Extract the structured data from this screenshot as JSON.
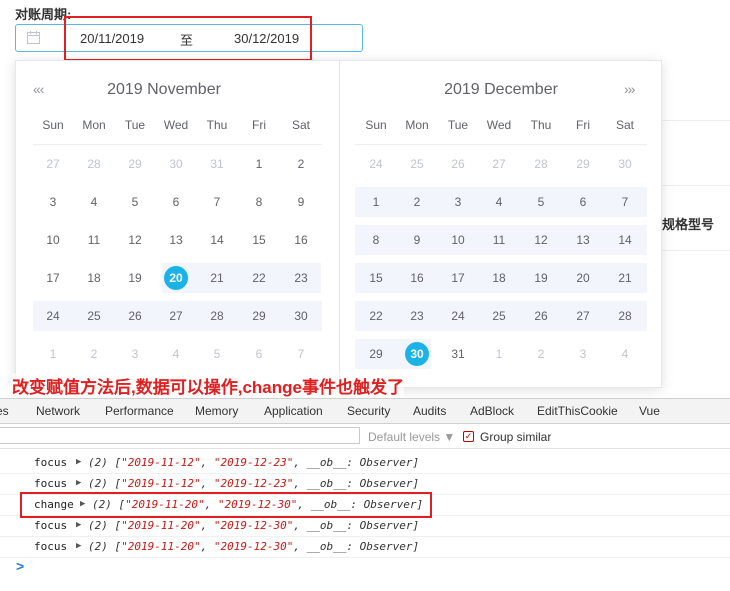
{
  "form": {
    "label": "对账周期:",
    "start_value": "20/11/2019",
    "separator": "至",
    "end_value": "30/12/2019"
  },
  "background_page": {
    "right_label": "规格型号"
  },
  "picker": {
    "left": {
      "title": "2019 November",
      "nav": "«‹",
      "weekdays": [
        "Sun",
        "Mon",
        "Tue",
        "Wed",
        "Thu",
        "Fri",
        "Sat"
      ],
      "rows": [
        [
          "27",
          "28",
          "29",
          "30",
          "31",
          "1",
          "2"
        ],
        [
          "3",
          "4",
          "5",
          "6",
          "7",
          "8",
          "9"
        ],
        [
          "10",
          "11",
          "12",
          "13",
          "14",
          "15",
          "16"
        ],
        [
          "17",
          "18",
          "19",
          "20",
          "21",
          "22",
          "23"
        ],
        [
          "24",
          "25",
          "26",
          "27",
          "28",
          "29",
          "30"
        ],
        [
          "1",
          "2",
          "3",
          "4",
          "5",
          "6",
          "7"
        ]
      ],
      "selected": "20"
    },
    "right": {
      "title": "2019 December",
      "nav": "›»",
      "weekdays": [
        "Sun",
        "Mon",
        "Tue",
        "Wed",
        "Thu",
        "Fri",
        "Sat"
      ],
      "rows": [
        [
          "24",
          "25",
          "26",
          "27",
          "28",
          "29",
          "30"
        ],
        [
          "1",
          "2",
          "3",
          "4",
          "5",
          "6",
          "7"
        ],
        [
          "8",
          "9",
          "10",
          "11",
          "12",
          "13",
          "14"
        ],
        [
          "15",
          "16",
          "17",
          "18",
          "19",
          "20",
          "21"
        ],
        [
          "22",
          "23",
          "24",
          "25",
          "26",
          "27",
          "28"
        ],
        [
          "29",
          "30",
          "31",
          "1",
          "2",
          "3",
          "4"
        ]
      ],
      "selected": "30"
    }
  },
  "annotation": "改变赋值方法后,数据可以操作,change事件也触发了",
  "devtools": {
    "tabs": [
      "es",
      "Network",
      "Performance",
      "Memory",
      "Application",
      "Security",
      "Audits",
      "AdBlock",
      "EditThisCookie",
      "Vue"
    ],
    "levels_label": "Default levels ▼",
    "check_mark": "✓",
    "group_similar": "Group similar",
    "logs": [
      {
        "event": "focus",
        "prefix": "(2) [",
        "a": "\"2019-11-12\"",
        "b": "\"2019-12-23\"",
        "suffix": ", __ob__: Observer]"
      },
      {
        "event": "focus",
        "prefix": "(2) [",
        "a": "\"2019-11-12\"",
        "b": "\"2019-12-23\"",
        "suffix": ", __ob__: Observer]"
      },
      {
        "event": "change",
        "prefix": "(2) [",
        "a": "\"2019-11-20\"",
        "b": "\"2019-12-30\"",
        "suffix": ", __ob__: Observer]"
      },
      {
        "event": "focus",
        "prefix": "(2) [",
        "a": "\"2019-11-20\"",
        "b": "\"2019-12-30\"",
        "suffix": ", __ob__: Observer]"
      },
      {
        "event": "focus",
        "prefix": "(2) [",
        "a": "\"2019-11-20\"",
        "b": "\"2019-12-30\"",
        "suffix": ", __ob__: Observer]"
      }
    ],
    "prompt": ">"
  },
  "colors": {
    "accent": "#1bb3e6",
    "highlight": "#e02020",
    "range_band": "#f2f6fc"
  },
  "icons": {
    "calendar": "calendar-icon",
    "expand": "triangle-right-icon"
  }
}
